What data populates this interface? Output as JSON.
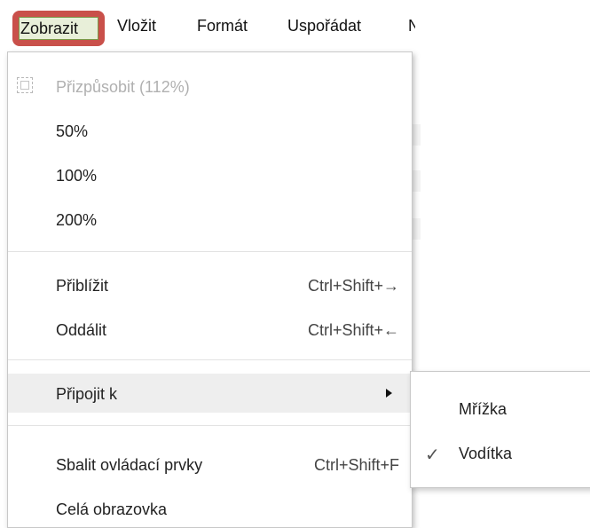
{
  "menubar": {
    "items": [
      {
        "label": "Zobrazit"
      },
      {
        "label": "Vložit"
      },
      {
        "label": "Formát"
      },
      {
        "label": "Uspořádat"
      },
      {
        "label": "N"
      }
    ]
  },
  "dropdown": {
    "zoom": {
      "fit": "Přizpůsobit (112%)",
      "p50": "50%",
      "p100": "100%",
      "p200": "200%"
    },
    "zoom_in": {
      "label": "Přiblížit",
      "shortcut": "Ctrl+Shift+→"
    },
    "zoom_out": {
      "label": "Oddálit",
      "shortcut": "Ctrl+Shift+←"
    },
    "snap_to": {
      "label": "Připojit k"
    },
    "collapse_controls": {
      "label": "Sbalit ovládací prvky",
      "shortcut": "Ctrl+Shift+F"
    },
    "fullscreen": {
      "label": "Celá obrazovka"
    }
  },
  "submenu": {
    "grid": {
      "label": "Mřížka",
      "checked": false
    },
    "guides": {
      "label": "Vodítka",
      "checked": true
    }
  }
}
